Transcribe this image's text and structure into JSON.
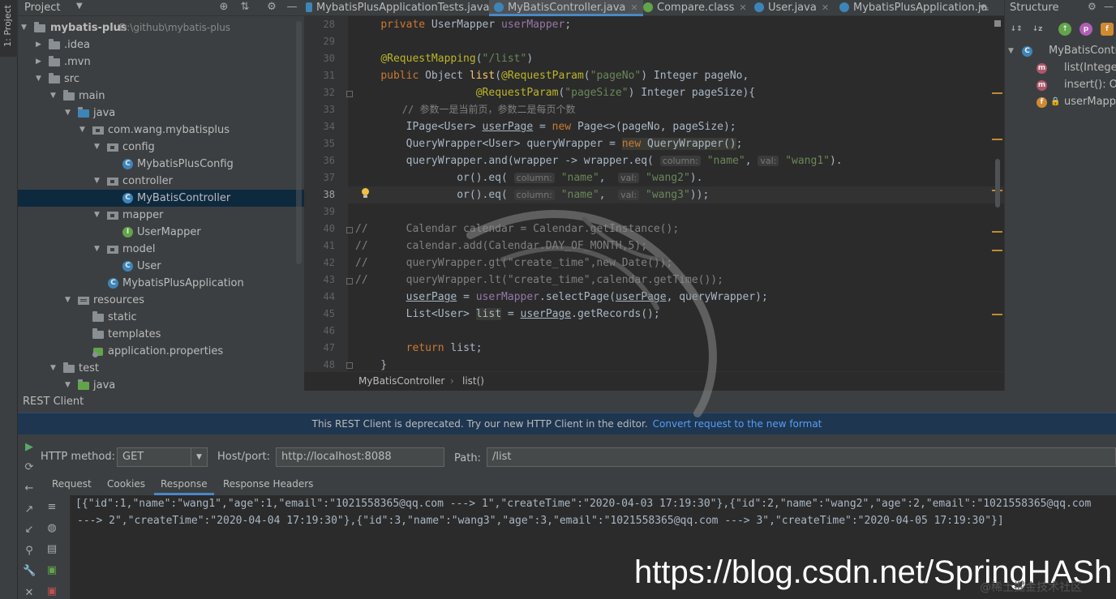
{
  "left_strip": {
    "tab_label": "1: Project"
  },
  "project": {
    "title": "Project",
    "tree": [
      {
        "label": "mybatis-plus",
        "extra": "D:\\github\\mybatis-plus",
        "icon": "folder"
      },
      {
        "label": ".idea",
        "icon": "folder"
      },
      {
        "label": ".mvn",
        "icon": "folder"
      },
      {
        "label": "src",
        "icon": "folder"
      },
      {
        "label": "main",
        "icon": "folder"
      },
      {
        "label": "java",
        "icon": "folder"
      },
      {
        "label": "com.wang.mybatisplus",
        "icon": "package"
      },
      {
        "label": "config",
        "icon": "package"
      },
      {
        "label": "MybatisPlusConfig",
        "icon": "class"
      },
      {
        "label": "controller",
        "icon": "package"
      },
      {
        "label": "MyBatisController",
        "icon": "class"
      },
      {
        "label": "mapper",
        "icon": "package"
      },
      {
        "label": "UserMapper",
        "icon": "interface"
      },
      {
        "label": "model",
        "icon": "package"
      },
      {
        "label": "User",
        "icon": "class"
      },
      {
        "label": "MybatisPlusApplication",
        "icon": "class"
      },
      {
        "label": "resources",
        "icon": "resources"
      },
      {
        "label": "static",
        "icon": "folder"
      },
      {
        "label": "templates",
        "icon": "folder"
      },
      {
        "label": "application.properties",
        "icon": "properties"
      },
      {
        "label": "test",
        "icon": "folder"
      },
      {
        "label": "java",
        "icon": "folder"
      }
    ]
  },
  "tabs": [
    {
      "label": "MybatisPlusApplicationTests.java"
    },
    {
      "label": "MyBatisController.java",
      "active": true
    },
    {
      "label": "Compare.class"
    },
    {
      "label": "User.java"
    },
    {
      "label": "MybatisPlusApplication.ja"
    }
  ],
  "editor": {
    "current_line": 38,
    "line_numbers": [
      "28",
      "29",
      "30",
      "31",
      "32",
      "33",
      "34",
      "35",
      "36",
      "37",
      "38",
      "39",
      "40",
      "41",
      "42",
      "43",
      "44",
      "45",
      "46",
      "47",
      "48"
    ],
    "comment_33": "// 参数一是当前页，参数二是每页个数",
    "hints": {
      "column": "column:",
      "val": "val:"
    }
  },
  "breadcrumb": {
    "class_name": "MyBatisController",
    "method": "list()"
  },
  "structure": {
    "title": "Structure",
    "items": [
      {
        "label": "MyBatisContro",
        "icon": "class"
      },
      {
        "label": "list(Integer,",
        "icon": "method"
      },
      {
        "label": "insert(): Ob",
        "icon": "method"
      },
      {
        "label": "userMappe",
        "icon": "field"
      }
    ]
  },
  "rest_client": {
    "title": "REST Client",
    "deprecation_text": "This REST Client is deprecated. Try our new HTTP Client in the editor.",
    "deprecation_link": "Convert request to the new format",
    "method_label": "HTTP method:",
    "method_value": "GET",
    "host_label": "Host/port:",
    "host_value": "http://localhost:8088",
    "path_label": "Path:",
    "path_value": "/list",
    "tabs": [
      "Request",
      "Cookies",
      "Response",
      "Response Headers"
    ],
    "active_tab": "Response",
    "response_line_1": "[{\"id\":1,\"name\":\"wang1\",\"age\":1,\"email\":\"1021558365@qq.com ---> 1\",\"createTime\":\"2020-04-03 17:19:30\"},{\"id\":2,\"name\":\"wang2\",\"age\":2,\"email\":\"1021558365@qq.com",
    "response_line_2": "---> 2\",\"createTime\":\"2020-04-04 17:19:30\"},{\"id\":3,\"name\":\"wang3\",\"age\":3,\"email\":\"1021558365@qq.com ---> 3\",\"createTime\":\"2020-04-05 17:19:30\"}]"
  },
  "watermark": {
    "url": "https://blog.csdn.net/SpringHASh",
    "small": "@稀土掘金技术社区"
  }
}
